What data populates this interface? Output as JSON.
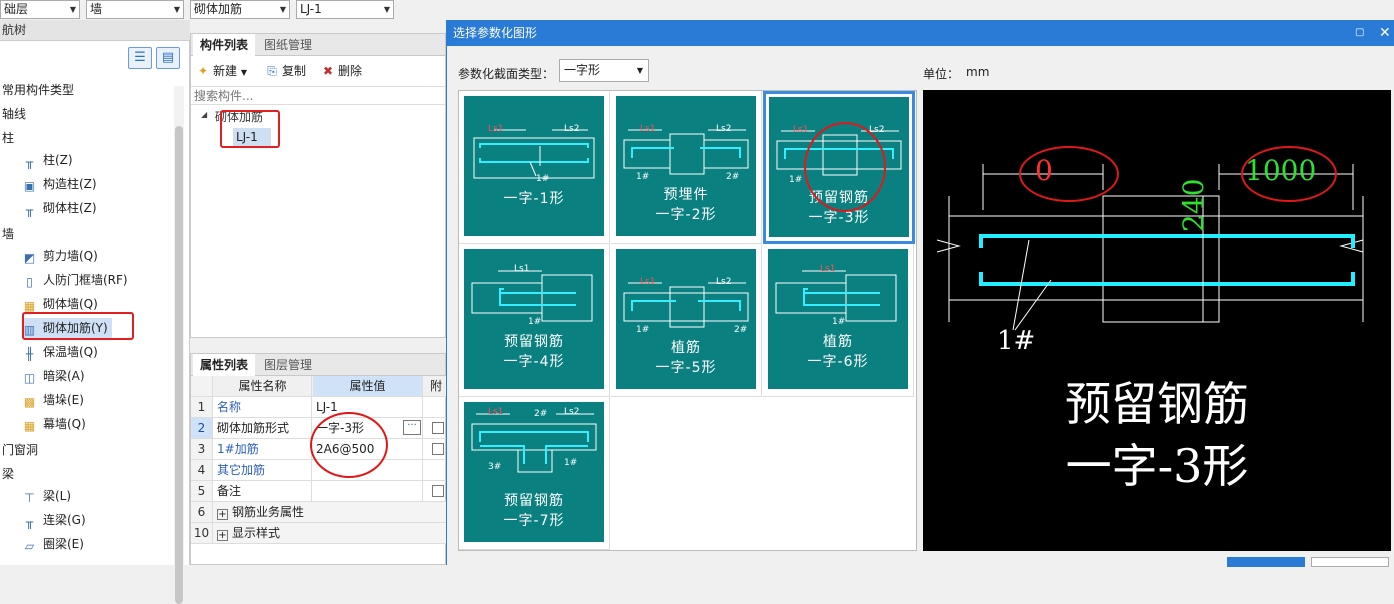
{
  "toolbar": {
    "floor_value": "础层",
    "category_value": "墙",
    "type_value": "砌体加筋",
    "component_value": "LJ-1"
  },
  "nav": {
    "header": "航树",
    "categories": [
      {
        "label": "常用构件类型"
      },
      {
        "label": "轴线"
      },
      {
        "label": "柱"
      },
      {
        "label": "墙"
      },
      {
        "label": "门窗洞"
      },
      {
        "label": "梁"
      }
    ],
    "items": [
      {
        "label": "柱(Z)",
        "icon": "column-icon"
      },
      {
        "label": "构造柱(Z)",
        "icon": "constructional-column-icon"
      },
      {
        "label": "砌体柱(Z)",
        "icon": "masonry-column-icon"
      },
      {
        "label": "剪力墙(Q)",
        "icon": "shear-wall-icon"
      },
      {
        "label": "人防门框墙(RF)",
        "icon": "civil-defense-wall-icon"
      },
      {
        "label": "砌体墙(Q)",
        "icon": "masonry-wall-icon"
      },
      {
        "label": "砌体加筋(Y)",
        "icon": "masonry-reinforcement-icon"
      },
      {
        "label": "保温墙(Q)",
        "icon": "insulation-wall-icon"
      },
      {
        "label": "暗梁(A)",
        "icon": "hidden-beam-icon"
      },
      {
        "label": "墙垛(E)",
        "icon": "wall-pier-icon"
      },
      {
        "label": "幕墙(Q)",
        "icon": "curtain-wall-icon"
      },
      {
        "label": "梁(L)",
        "icon": "beam-icon"
      },
      {
        "label": "连梁(G)",
        "icon": "coupling-beam-icon"
      },
      {
        "label": "圈梁(E)",
        "icon": "ring-beam-icon"
      }
    ]
  },
  "component_panel": {
    "tabs": [
      "构件列表",
      "图纸管理"
    ],
    "new_label": "新建",
    "copy_label": "复制",
    "delete_label": "删除",
    "search_placeholder": "搜索构件...",
    "tree_root": "砌体加筋",
    "tree_child": "LJ-1"
  },
  "property_panel": {
    "tabs": [
      "属性列表",
      "图层管理"
    ],
    "col_name": "属性名称",
    "col_value": "属性值",
    "col_extra": "附",
    "rows": [
      {
        "num": "1",
        "name": "名称",
        "value": "LJ-1",
        "blue": true,
        "check": false
      },
      {
        "num": "2",
        "name": "砌体加筋形式",
        "value": "一字-3形",
        "blue": false,
        "check": true
      },
      {
        "num": "3",
        "name": "1#加筋",
        "value": "2A6@500",
        "blue": true,
        "check": true
      },
      {
        "num": "4",
        "name": "其它加筋",
        "value": "",
        "blue": true,
        "check": false
      },
      {
        "num": "5",
        "name": "备注",
        "value": "",
        "blue": false,
        "check": true
      },
      {
        "num": "6",
        "name": "钢筋业务属性",
        "value": "",
        "blue": false,
        "check": false
      },
      {
        "num": "10",
        "name": "显示样式",
        "value": "",
        "blue": false,
        "check": false
      }
    ]
  },
  "dialog": {
    "title": "选择参数化图形",
    "section_label": "参数化截面类型：",
    "section_value": "一字形",
    "unit_label": "单位：",
    "unit_value": "mm",
    "shapes": [
      {
        "line1": "",
        "line2": "一字-1形",
        "lbl_a": "Ls1",
        "lbl_b": "Ls2",
        "tag": "1#"
      },
      {
        "line1": "预埋件",
        "line2": "一字-2形",
        "lbl_a": "Ls1",
        "lbl_b": "Ls2",
        "tag": "1#",
        "tag2": "2#"
      },
      {
        "line1": "预留钢筋",
        "line2": "一字-3形",
        "lbl_a": "Ls1",
        "lbl_b": "Ls2",
        "tag": "1#"
      },
      {
        "line1": "预留钢筋",
        "line2": "一字-4形",
        "lbl_a": "Ls1",
        "lbl_b": "",
        "tag": "1#"
      },
      {
        "line1": "植筋",
        "line2": "一字-5形",
        "lbl_a": "Ls1",
        "lbl_b": "Ls2",
        "tag": "1#",
        "tag2": "2#"
      },
      {
        "line1": "植筋",
        "line2": "一字-6形",
        "lbl_a": "Ls1",
        "lbl_b": "",
        "tag": "1#"
      },
      {
        "line1": "预留钢筋",
        "line2": "一字-7形",
        "lbl_a": "Ls1",
        "lbl_b": "Ls2",
        "tag": "1#",
        "tag2": "2#",
        "tag3": "3#"
      }
    ],
    "preview": {
      "dim_left": "0",
      "dim_right": "1000",
      "dim_height": "240",
      "tag": "1#",
      "line1": "预留钢筋",
      "line2": "一字-3形"
    }
  }
}
